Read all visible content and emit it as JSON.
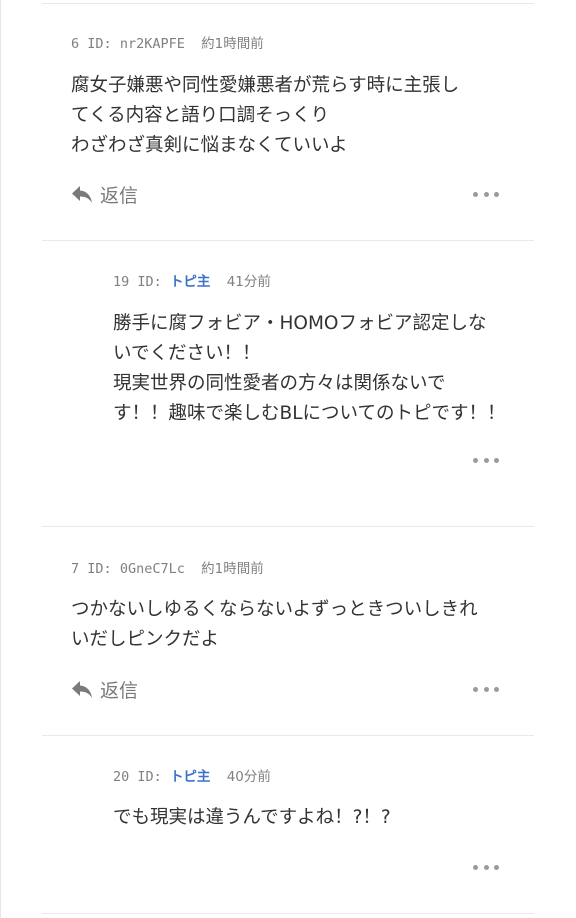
{
  "comments": [
    {
      "number": "6",
      "id_label": "ID:",
      "user_id": "nr2KAPFE",
      "time": "約1時間前",
      "lines": [
        "腐女子嫌悪や同性愛嫌悪者が荒らす時に主張し",
        "てくる内容と語り口調そっくり",
        "わざわざ真剣に悩まなくていいよ"
      ],
      "reply_label": "返信"
    },
    {
      "number": "19",
      "id_label": "ID:",
      "user_id": "トピ主",
      "time": "41分前",
      "lines": [
        "勝手に腐フォビア・HOMOフォビア認定しな",
        "いでください！！",
        "現実世界の同性愛者の方々は関係ないで",
        "す！！趣味で楽しむBLについてのトピです！！"
      ]
    },
    {
      "number": "7",
      "id_label": "ID:",
      "user_id": "0GneC7Lc",
      "time": "約1時間前",
      "lines": [
        "つかないしゆるくならないよずっときついしきれ",
        "いだしピンクだよ"
      ],
      "reply_label": "返信"
    },
    {
      "number": "20",
      "id_label": "ID:",
      "user_id": "トピ主",
      "time": "40分前",
      "lines": [
        "でも現実は違うんですよね！?！?"
      ]
    }
  ],
  "icons": {
    "reply": "reply-arrow-icon",
    "more": "more-options-icon"
  },
  "colors": {
    "op_badge": "#3b73c8",
    "meta_text": "#808080",
    "body_text": "#333333"
  }
}
